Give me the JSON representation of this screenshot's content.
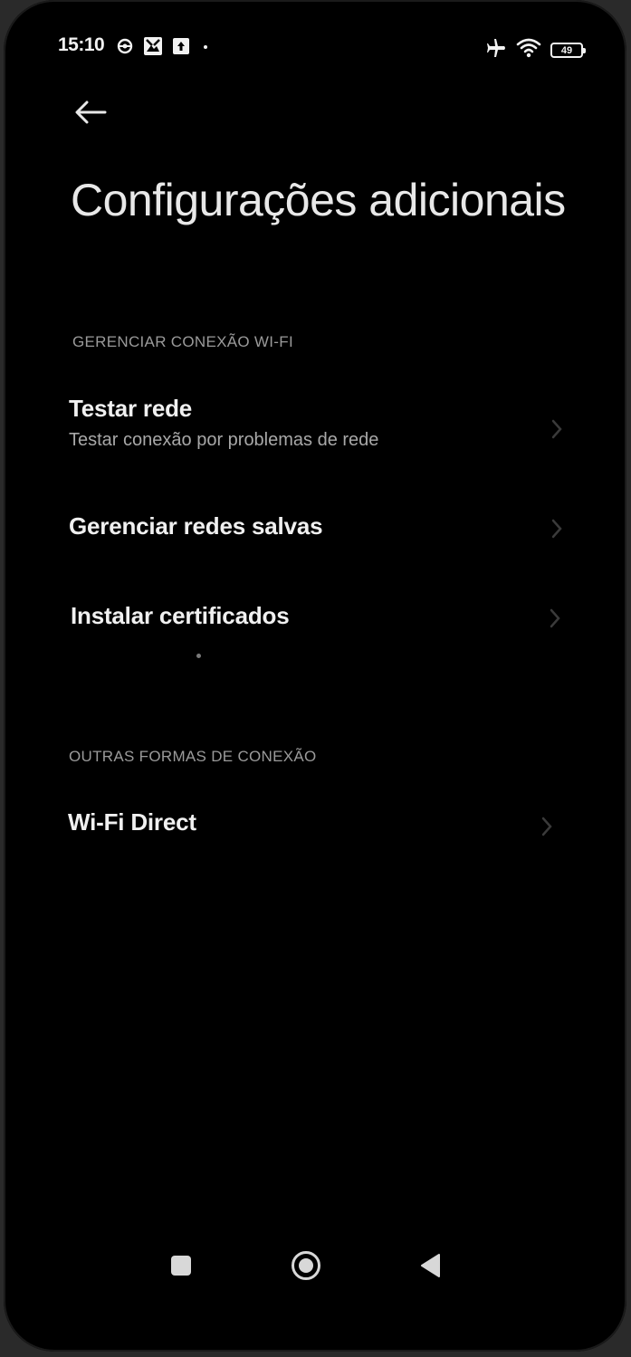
{
  "status_bar": {
    "time": "15:10",
    "battery_level": "49",
    "icons_left": [
      "sync-gear-icon",
      "photo-icon",
      "upload-icon",
      "dot-icon"
    ],
    "icons_right": [
      "airplane-icon",
      "wifi-icon",
      "battery-icon"
    ]
  },
  "header": {
    "back_icon": "arrow-left-icon",
    "title": "Configurações adicionais"
  },
  "sections": [
    {
      "header": "GERENCIAR CONEXÃO WI-FI",
      "items": [
        {
          "title": "Testar rede",
          "subtitle": "Testar conexão por problemas de rede"
        },
        {
          "title": "Gerenciar redes salvas"
        },
        {
          "title": "Instalar certificados"
        }
      ]
    },
    {
      "header": "OUTRAS FORMAS DE CONEXÃO",
      "items": [
        {
          "title": "Wi-Fi Direct"
        }
      ]
    }
  ],
  "nav_bar": {
    "buttons": [
      "recents-square-icon",
      "home-circle-icon",
      "back-triangle-icon"
    ]
  },
  "colors": {
    "background": "#000000",
    "title_text": "#e8e8e8",
    "item_text": "#f0f0f0",
    "subtitle_text": "#a8a8a8",
    "section_header_text": "#9a9a9a",
    "chevron": "#3a3a3a"
  }
}
